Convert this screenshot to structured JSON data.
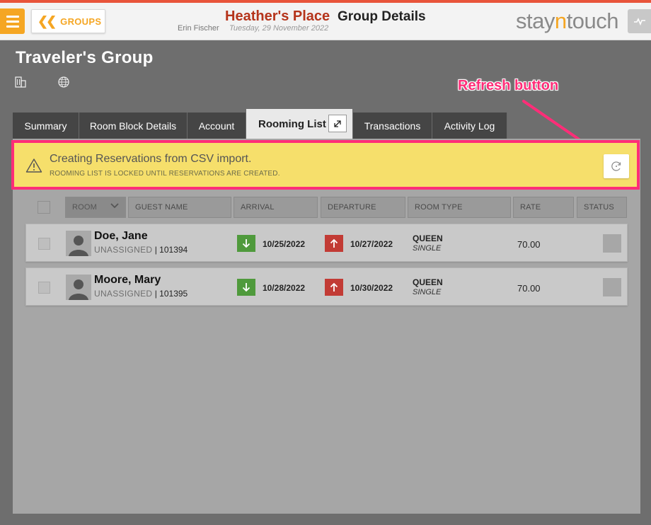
{
  "header": {
    "groups_label": "GROUPS",
    "hotel_name": "Heather's Place",
    "page_title": "Group Details",
    "user_name": "Erin Fischer",
    "date": "Tuesday, 29 November 2022",
    "logo_pre": "stay",
    "logo_accent": "n",
    "logo_post": "touch"
  },
  "group": {
    "name": "Traveler's Group"
  },
  "tabs": [
    {
      "label": "Summary"
    },
    {
      "label": "Room Block Details"
    },
    {
      "label": "Account"
    },
    {
      "label": "Rooming List",
      "active": true
    },
    {
      "label": "Transactions"
    },
    {
      "label": "Activity Log"
    }
  ],
  "annotation": {
    "label": "Refresh button"
  },
  "banner": {
    "title": "Creating Reservations from CSV import.",
    "subtitle": "ROOMING LIST IS LOCKED UNTIL RESERVATIONS ARE CREATED."
  },
  "columns": {
    "room": "ROOM",
    "guest_name": "GUEST NAME",
    "arrival": "ARRIVAL",
    "departure": "DEPARTURE",
    "room_type": "ROOM TYPE",
    "rate": "RATE",
    "status": "STATUS"
  },
  "rows": [
    {
      "name": "Doe, Jane",
      "assignment": "UNASSIGNED",
      "separator": "|",
      "confirmation": "101394",
      "arrival": "10/25/2022",
      "departure": "10/27/2022",
      "room_type": "QUEEN",
      "bed_type": "SINGLE",
      "rate": "70.00"
    },
    {
      "name": "Moore, Mary",
      "assignment": "UNASSIGNED",
      "separator": "|",
      "confirmation": "101395",
      "arrival": "10/28/2022",
      "departure": "10/30/2022",
      "room_type": "QUEEN",
      "bed_type": "SINGLE",
      "rate": "70.00"
    }
  ],
  "colors": {
    "accent": "#f5a623",
    "hotel_red": "#b5341b",
    "banner_yellow": "#f6df6b",
    "annotation_pink": "#ff2d78",
    "arrival_green": "#4f9a3c",
    "departure_red": "#c23b35"
  },
  "icons": {
    "menu": "hamburger-icon",
    "back": "double-chevron-left-icon",
    "pulse": "pulse-icon",
    "building": "building-icon",
    "globe": "globe-icon",
    "warning": "warning-icon",
    "refresh": "refresh-icon",
    "popout": "external-window-icon",
    "arrival": "arrow-down-icon",
    "departure": "arrow-up-icon"
  }
}
